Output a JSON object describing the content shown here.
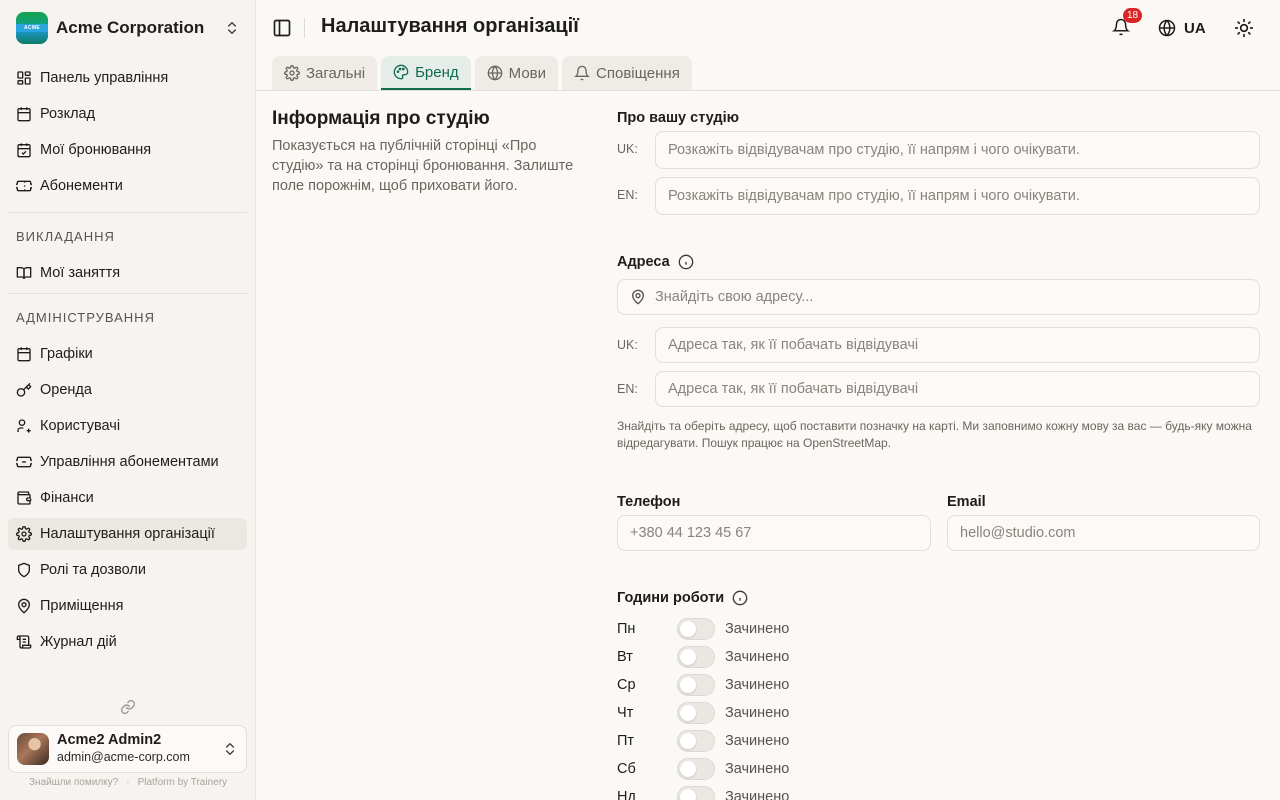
{
  "org": {
    "name": "Acme Corporation",
    "logo_text": "ACME"
  },
  "nav": {
    "main": [
      {
        "label": "Панель управління",
        "icon": "dashboard-icon"
      },
      {
        "label": "Розклад",
        "icon": "calendar-icon"
      },
      {
        "label": "Мої бронювання",
        "icon": "calendar-check-icon"
      },
      {
        "label": "Абонементи",
        "icon": "ticket-icon"
      }
    ],
    "teaching_title": "ВИКЛАДАННЯ",
    "teaching": [
      {
        "label": "Мої заняття",
        "icon": "book-icon"
      }
    ],
    "admin_title": "АДМІНІСТРУВАННЯ",
    "admin": [
      {
        "label": "Графіки",
        "icon": "calendar-grid-icon"
      },
      {
        "label": "Оренда",
        "icon": "key-icon"
      },
      {
        "label": "Користувачі",
        "icon": "users-icon"
      },
      {
        "label": "Управління абонементами",
        "icon": "tickets-icon"
      },
      {
        "label": "Фінанси",
        "icon": "wallet-icon"
      },
      {
        "label": "Налаштування організації",
        "icon": "gear-icon"
      },
      {
        "label": "Ролі та дозволи",
        "icon": "shield-icon"
      },
      {
        "label": "Приміщення",
        "icon": "map-pin-icon"
      },
      {
        "label": "Журнал дій",
        "icon": "scroll-icon"
      }
    ]
  },
  "user": {
    "name": "Acme2 Admin2",
    "email": "admin@acme-corp.com"
  },
  "footer": {
    "bug": "Знайшли помилку?",
    "dot": "·",
    "platform": "Platform by Trainery"
  },
  "header": {
    "title": "Налаштування організації",
    "notifications": "18",
    "language": "UA"
  },
  "tabs": [
    {
      "label": "Загальні",
      "icon": "gear-icon"
    },
    {
      "label": "Бренд",
      "icon": "palette-icon"
    },
    {
      "label": "Мови",
      "icon": "globe-icon"
    },
    {
      "label": "Сповіщення",
      "icon": "bell-icon"
    }
  ],
  "section": {
    "heading": "Інформація про студію",
    "description": "Показується на публічній сторінці «Про студію» та на сторінці бронювання. Залиште поле порожнім, щоб приховати його."
  },
  "about": {
    "label": "Про вашу студію",
    "uk_tag": "UK:",
    "en_tag": "EN:",
    "uk_placeholder": "Розкажіть відвідувачам про студію, її напрям і чого очікувати.",
    "en_placeholder": "Розкажіть відвідувачам про студію, її напрям і чого очікувати."
  },
  "address": {
    "label": "Адреса",
    "search_placeholder": "Знайдіть свою адресу...",
    "uk_tag": "UK:",
    "en_tag": "EN:",
    "uk_placeholder": "Адреса так, як її побачать відвідувачі",
    "en_placeholder": "Адреса так, як її побачать відвідувачі",
    "hint": "Знайдіть та оберіть адресу, щоб поставити позначку на карті. Ми заповнимо кожну мову за вас — будь-яку можна відредагувати. Пошук працює на OpenStreetMap."
  },
  "phone": {
    "label": "Телефон",
    "placeholder": "+380 44 123 45 67"
  },
  "email": {
    "label": "Email",
    "placeholder": "hello@studio.com"
  },
  "hours": {
    "label": "Години роботи",
    "days": [
      {
        "day": "Пн",
        "status": "Зачинено"
      },
      {
        "day": "Вт",
        "status": "Зачинено"
      },
      {
        "day": "Ср",
        "status": "Зачинено"
      },
      {
        "day": "Чт",
        "status": "Зачинено"
      },
      {
        "day": "Пт",
        "status": "Зачинено"
      },
      {
        "day": "Сб",
        "status": "Зачинено"
      },
      {
        "day": "Нд",
        "status": "Зачинено"
      }
    ]
  },
  "colors": {
    "accent": "#0f6b4e",
    "badge": "#dc2626",
    "active_nav": "#ebe7e1"
  }
}
